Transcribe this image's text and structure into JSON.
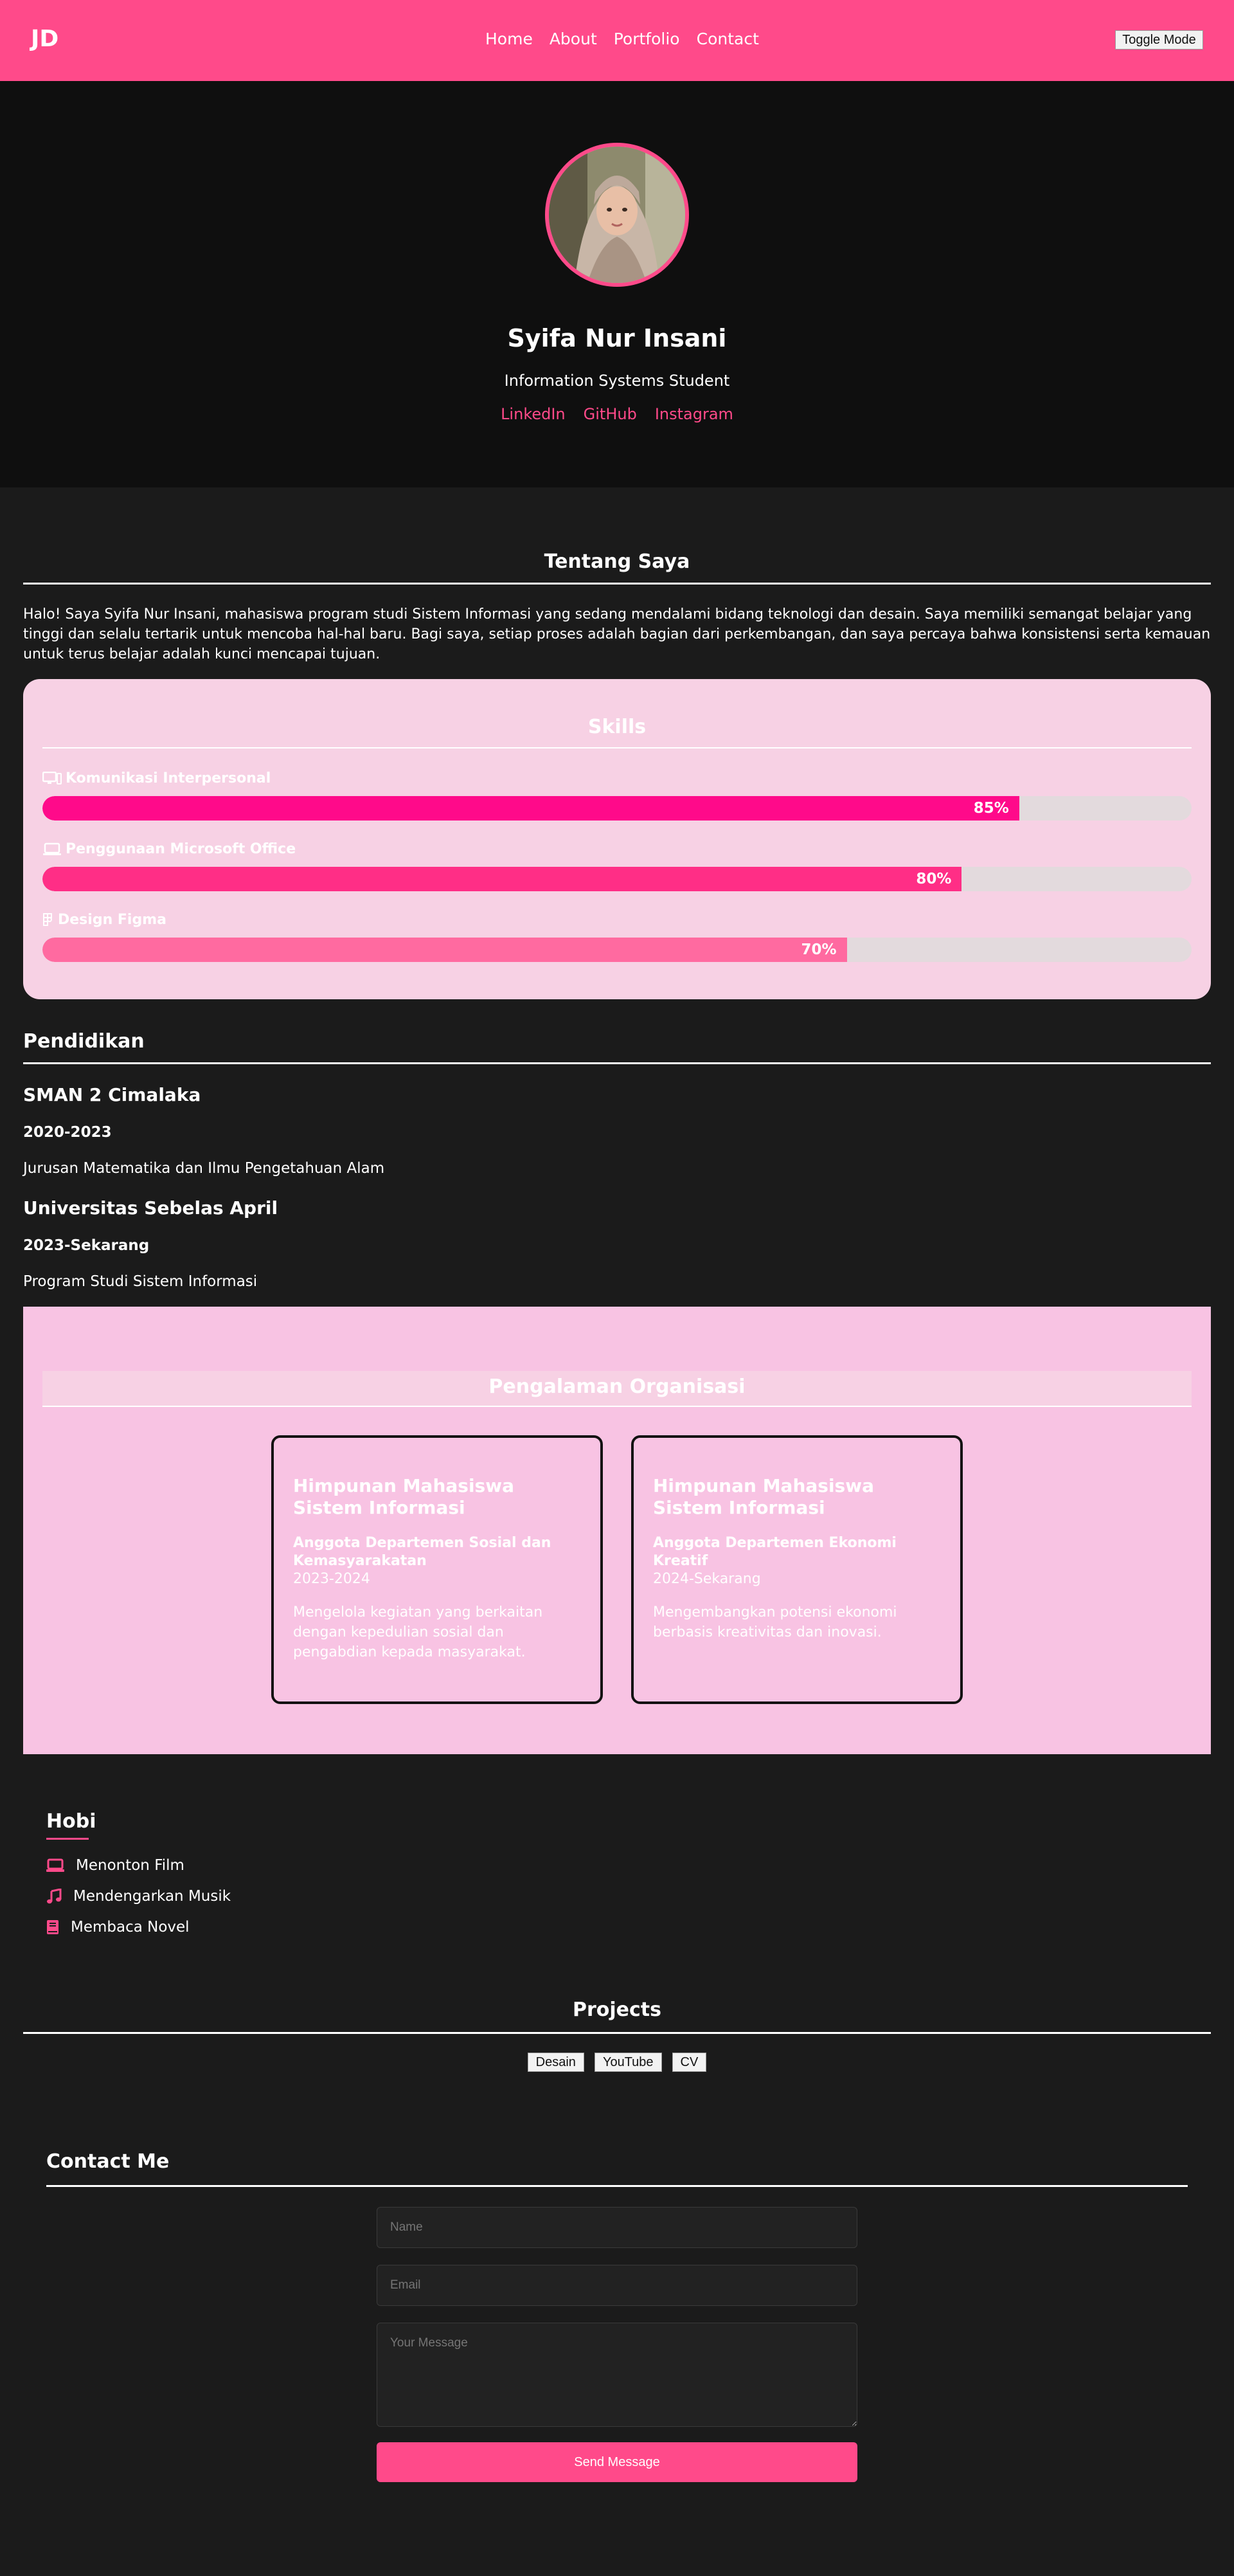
{
  "nav": {
    "logo": "JD",
    "items": [
      {
        "label": "Home"
      },
      {
        "label": "About"
      },
      {
        "label": "Portfolio"
      },
      {
        "label": "Contact"
      }
    ],
    "toggle_label": "Toggle Mode"
  },
  "hero": {
    "name": "Syifa Nur Insani",
    "role": "Information Systems Student",
    "links": [
      {
        "label": "LinkedIn"
      },
      {
        "label": "GitHub"
      },
      {
        "label": "Instagram"
      }
    ]
  },
  "about": {
    "title": "Tentang Saya",
    "text": "Halo! Saya Syifa Nur Insani, mahasiswa program studi Sistem Informasi yang sedang mendalami bidang teknologi dan desain. Saya memiliki semangat belajar yang tinggi dan selalu tertarik untuk mencoba hal-hal baru. Bagi saya, setiap proses adalah bagian dari perkembangan, dan saya percaya bahwa konsistensi serta kemauan untuk terus belajar adalah kunci mencapai tujuan."
  },
  "skills": {
    "title": "Skills",
    "items": [
      {
        "label": "Komunikasi Interpersonal",
        "icon": "monitor-icon",
        "percent": 85,
        "percent_label": "85%",
        "color": "#ff0a8a"
      },
      {
        "label": "Penggunaan Microsoft Office",
        "icon": "laptop-icon",
        "percent": 80,
        "percent_label": "80%",
        "color": "#ff2e86"
      },
      {
        "label": "Design Figma",
        "icon": "figma-icon",
        "percent": 70,
        "percent_label": "70%",
        "color": "#ff6aa0"
      }
    ]
  },
  "education": {
    "title": "Pendidikan",
    "items": [
      {
        "school": "SMAN 2 Cimalaka",
        "years": "2020-2023",
        "major": "Jurusan Matematika dan Ilmu Pengetahuan Alam"
      },
      {
        "school": "Universitas Sebelas April",
        "years": "2023-Sekarang",
        "major": "Program Studi Sistem Informasi"
      }
    ]
  },
  "organization": {
    "title": "Pengalaman Organisasi",
    "cards": [
      {
        "org": "Himpunan Mahasiswa Sistem Informasi",
        "role": "Anggota Departemen Sosial dan Kemasyarakatan",
        "period": "2023-2024",
        "desc": "Mengelola kegiatan yang berkaitan dengan kepedulian sosial dan pengabdian kepada masyarakat."
      },
      {
        "org": "Himpunan Mahasiswa Sistem Informasi",
        "role": "Anggota Departemen Ekonomi Kreatif",
        "period": "2024-Sekarang",
        "desc": "Mengembangkan potensi ekonomi berbasis kreativitas dan inovasi."
      }
    ]
  },
  "hobbies": {
    "title": "Hobi",
    "items": [
      {
        "label": "Menonton Film",
        "icon": "laptop-icon"
      },
      {
        "label": "Mendengarkan Musik",
        "icon": "music-icon"
      },
      {
        "label": "Membaca Novel",
        "icon": "book-icon"
      }
    ]
  },
  "projects": {
    "title": "Projects",
    "buttons": [
      {
        "label": "Desain"
      },
      {
        "label": "YouTube"
      },
      {
        "label": "CV"
      }
    ]
  },
  "contact": {
    "title": "Contact Me",
    "name_placeholder": "Name",
    "email_placeholder": "Email",
    "message_placeholder": "Your Message",
    "send_label": "Send Message"
  },
  "colors": {
    "accent": "#ff4a8a",
    "background": "#1b1b1b",
    "hero_background": "#0f0f0f",
    "skills_card": "#f7d1e4",
    "org_section": "#f8c3e3"
  }
}
